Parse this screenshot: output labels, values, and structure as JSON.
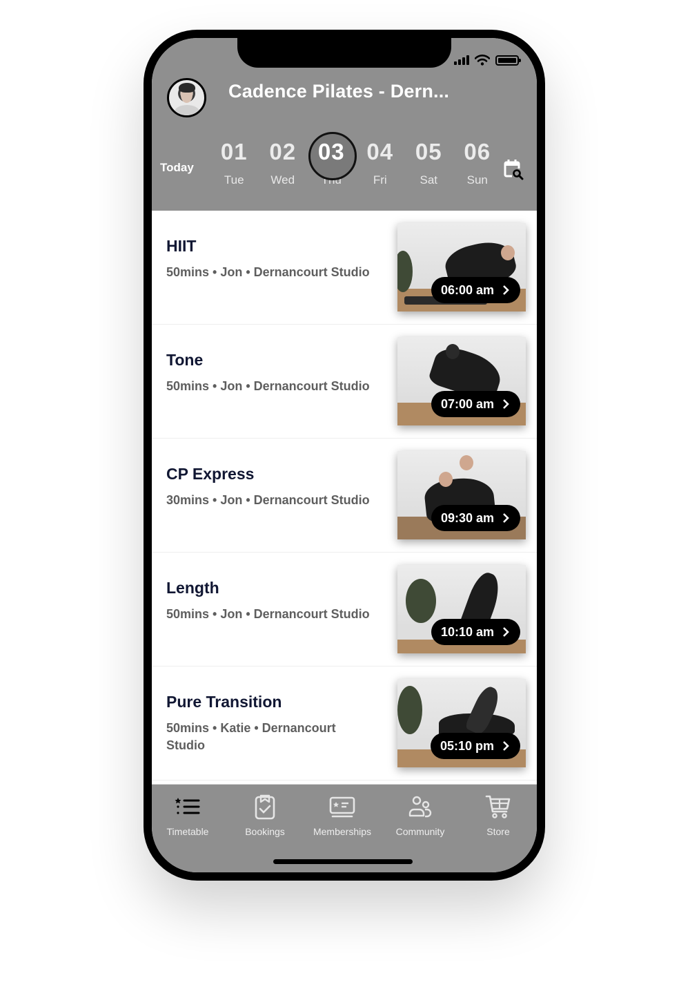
{
  "status_bar": {
    "signal_icon": "cellular-signal-icon",
    "wifi_icon": "wifi-icon",
    "battery_icon": "battery-icon"
  },
  "header": {
    "avatar_icon": "profile-avatar",
    "title": "Cadence Pilates - Dern...",
    "today_label": "Today",
    "calendar_search_icon": "calendar-search-icon",
    "dates": [
      {
        "num": "01",
        "day": "Tue",
        "selected": false
      },
      {
        "num": "02",
        "day": "Wed",
        "selected": false
      },
      {
        "num": "03",
        "day": "Thu",
        "selected": true
      },
      {
        "num": "04",
        "day": "Fri",
        "selected": false
      },
      {
        "num": "05",
        "day": "Sat",
        "selected": false
      },
      {
        "num": "06",
        "day": "Sun",
        "selected": false
      }
    ]
  },
  "classes": [
    {
      "name": "HIIT",
      "meta": "50mins • Jon • Dernancourt Studio",
      "time": "06:00 am"
    },
    {
      "name": "Tone",
      "meta": "50mins • Jon • Dernancourt Studio",
      "time": "07:00 am"
    },
    {
      "name": "CP Express",
      "meta": "30mins • Jon • Dernancourt Studio",
      "time": "09:30 am"
    },
    {
      "name": "Length",
      "meta": "50mins • Jon • Dernancourt Studio",
      "time": "10:10 am"
    },
    {
      "name": "Pure Transition",
      "meta": "50mins • Katie • Dernancourt Studio",
      "time": "05:10 pm"
    }
  ],
  "tabbar": {
    "items": [
      {
        "label": "Timetable",
        "icon": "timetable-list-icon"
      },
      {
        "label": "Bookings",
        "icon": "clipboard-check-icon"
      },
      {
        "label": "Memberships",
        "icon": "membership-card-icon"
      },
      {
        "label": "Community",
        "icon": "community-people-icon"
      },
      {
        "label": "Store",
        "icon": "shopping-cart-icon"
      }
    ]
  },
  "colors": {
    "header_bg": "#8f8f8f",
    "title_text": "#111733",
    "meta_text": "#5e5e5e",
    "pill_bg": "#000000"
  }
}
